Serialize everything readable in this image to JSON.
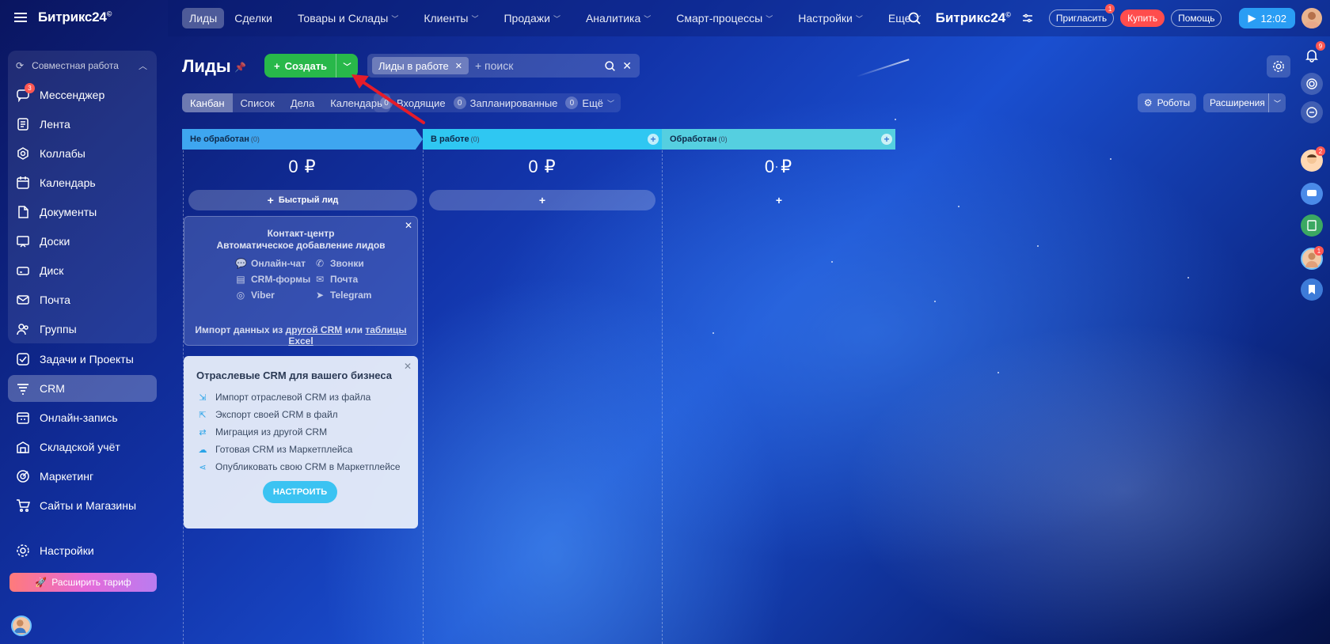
{
  "app": {
    "brand": "Битрикс24",
    "brand_sup": "©"
  },
  "sidebar": {
    "group_label": "Совместная работа",
    "items": [
      {
        "label": "Мессенджер",
        "icon": "messenger-icon",
        "badge": "3"
      },
      {
        "label": "Лента",
        "icon": "feed-icon"
      },
      {
        "label": "Коллабы",
        "icon": "collab-icon"
      },
      {
        "label": "Календарь",
        "icon": "calendar-icon"
      },
      {
        "label": "Документы",
        "icon": "documents-icon"
      },
      {
        "label": "Доски",
        "icon": "boards-icon"
      },
      {
        "label": "Диск",
        "icon": "disk-icon"
      },
      {
        "label": "Почта",
        "icon": "mail-icon"
      },
      {
        "label": "Группы",
        "icon": "groups-icon"
      },
      {
        "label": "Задачи и Проекты",
        "icon": "tasks-icon"
      },
      {
        "label": "CRM",
        "icon": "crm-icon",
        "active": true
      },
      {
        "label": "Онлайн-запись",
        "icon": "booking-icon"
      },
      {
        "label": "Складской учёт",
        "icon": "warehouse-icon"
      },
      {
        "label": "Маркетинг",
        "icon": "marketing-icon"
      },
      {
        "label": "Сайты и Магазины",
        "icon": "cart-icon"
      }
    ],
    "settings_label": "Настройки",
    "upgrade_label": "Расширить тариф"
  },
  "topbar": {
    "menu": [
      {
        "label": "Лиды",
        "active": true
      },
      {
        "label": "Сделки"
      },
      {
        "label": "Товары и Склады",
        "dropdown": true
      },
      {
        "label": "Клиенты",
        "dropdown": true
      },
      {
        "label": "Продажи",
        "dropdown": true
      },
      {
        "label": "Аналитика",
        "dropdown": true
      },
      {
        "label": "Смарт-процессы",
        "dropdown": true
      },
      {
        "label": "Настройки",
        "dropdown": true
      },
      {
        "label": "Еще",
        "dropdown": true
      }
    ],
    "invite_label": "Пригласить",
    "invite_badge": "1",
    "buy_label": "Купить",
    "help_label": "Помощь",
    "time": "12:02"
  },
  "toolbar": {
    "title": "Лиды",
    "create_label": "Создать",
    "filter_chip": "Лиды в работе",
    "search_placeholder": "+ поиск",
    "views": [
      "Канбан",
      "Список",
      "Дела",
      "Календарь"
    ],
    "counters": [
      {
        "n": "0",
        "label": "Входящие"
      },
      {
        "n": "0",
        "label": "Запланированные"
      },
      {
        "n": "0",
        "label": "Ещё"
      }
    ],
    "robots_label": "Роботы",
    "extensions_label": "Расширения"
  },
  "kanban": {
    "columns": [
      {
        "name": "Не обработан",
        "count": "(0)",
        "sum": "0 ₽",
        "color": "#3ea6f0",
        "quick": "Быстрый лид"
      },
      {
        "name": "В работе",
        "count": "(0)",
        "sum": "0 ₽",
        "color": "#2fc7f2",
        "quick": ""
      },
      {
        "name": "Обработан",
        "count": "(0)",
        "sum": "0 ₽",
        "color": "#55cfe0",
        "quick": ""
      }
    ]
  },
  "contact_center": {
    "title": "Контакт-центр",
    "subtitle": "Автоматическое добавление лидов",
    "channels": [
      "Онлайн-чат",
      "Звонки",
      "CRM-формы",
      "Почта",
      "Viber",
      "Telegram"
    ],
    "import_prefix": "Импорт данных из",
    "import_link1": "другой CRM",
    "import_mid": "или",
    "import_link2": "таблицы Excel"
  },
  "industry_crm": {
    "title": "Отраслевые CRM для вашего бизнеса",
    "items": [
      "Импорт отраслевой CRM из файла",
      "Экспорт своей CRM в файл",
      "Миграция из другой CRM",
      "Готовая CRM из Маркетплейса",
      "Опубликовать свою CRM в Маркетплейсе"
    ],
    "button": "НАСТРОИТЬ"
  },
  "right_rail": {
    "notifications_badge": "9",
    "contact_badge": "2",
    "user_badge": "1"
  }
}
